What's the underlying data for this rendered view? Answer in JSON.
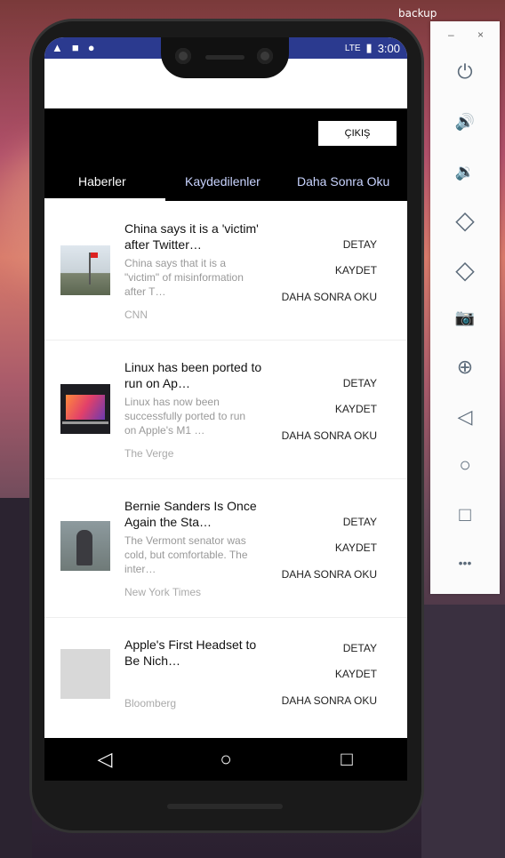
{
  "window": {
    "title": "backup"
  },
  "statusbar": {
    "time": "3:00",
    "network": "LTE"
  },
  "toolbar": {
    "logout_label": "ÇIKIŞ",
    "tabs": [
      {
        "label": "Haberler",
        "active": true
      },
      {
        "label": "Kaydedilenler",
        "active": false
      },
      {
        "label": "Daha Sonra Oku",
        "active": false
      }
    ]
  },
  "news": [
    {
      "title": "China says it is a 'victim' after Twitter…",
      "desc": "China says that it is a \"victim\" of misinformation after T…",
      "source": "CNN"
    },
    {
      "title": "Linux has been ported to run on Ap…",
      "desc": "Linux has now been successfully ported to run on Apple's M1 …",
      "source": "The Verge"
    },
    {
      "title": "Bernie Sanders Is Once Again the Sta…",
      "desc": "The Vermont senator was cold, but comfortable. The inter…",
      "source": "New York Times"
    },
    {
      "title": "Apple's First Headset to Be Nich…",
      "desc": "",
      "source": "Bloomberg"
    }
  ],
  "actions": {
    "detail": "DETAY",
    "save": "KAYDET",
    "read_later": "DAHA SONRA OKU"
  },
  "navbar": {
    "back_icon": "◁",
    "home_icon": "○",
    "recents_icon": "□"
  },
  "emulator": {
    "minimize": "–",
    "close": "×",
    "buttons": [
      {
        "icon": "power-icon",
        "glyph": "⏻"
      },
      {
        "icon": "volume-up-icon",
        "glyph": "🔊"
      },
      {
        "icon": "volume-down-icon",
        "glyph": "🔉"
      },
      {
        "icon": "rotate-left-icon",
        "glyph": "◇"
      },
      {
        "icon": "rotate-right-icon",
        "glyph": "◇"
      },
      {
        "icon": "camera-icon",
        "glyph": "📷"
      },
      {
        "icon": "zoom-icon",
        "glyph": "⊕"
      },
      {
        "icon": "back-icon",
        "glyph": "◁"
      },
      {
        "icon": "home-icon",
        "glyph": "○"
      },
      {
        "icon": "overview-icon",
        "glyph": "□"
      },
      {
        "icon": "more-icon",
        "glyph": "•••"
      }
    ]
  }
}
